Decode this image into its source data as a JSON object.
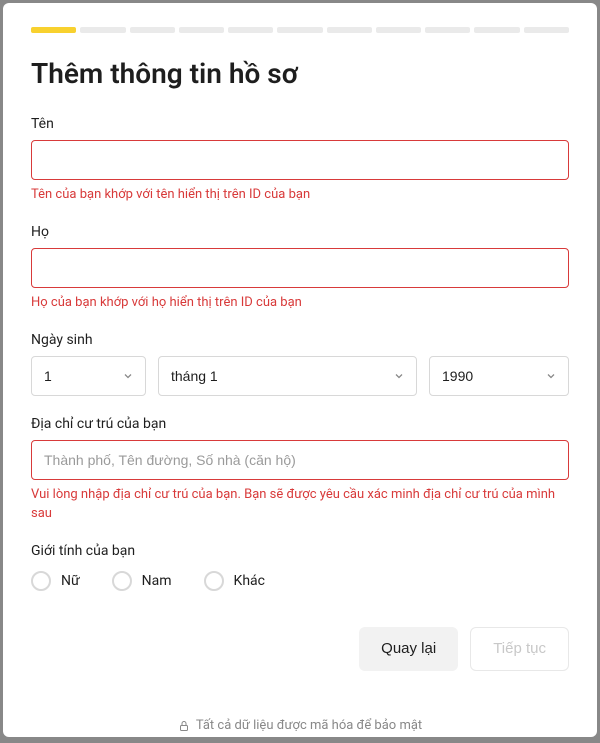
{
  "progress": {
    "total_segments": 11,
    "active_segment": 0
  },
  "title": "Thêm thông tin hồ sơ",
  "fields": {
    "first_name": {
      "label": "Tên",
      "value": "",
      "error": "Tên của bạn khớp với tên hiển thị trên ID của bạn"
    },
    "last_name": {
      "label": "Họ",
      "value": "",
      "error": "Họ của bạn khớp với họ hiển thị trên ID của bạn"
    },
    "dob": {
      "label": "Ngày sinh",
      "day": "1",
      "month": "tháng 1",
      "year": "1990"
    },
    "address": {
      "label": "Địa chỉ cư trú của bạn",
      "placeholder": "Thành phố, Tên đường, Số nhà (căn hộ)",
      "value": "",
      "error": "Vui lòng nhập địa chỉ cư trú của bạn. Bạn sẽ được yêu cầu xác minh địa chỉ cư trú của mình sau"
    },
    "gender": {
      "label": "Giới tính của bạn",
      "options": [
        {
          "label": "Nữ"
        },
        {
          "label": "Nam"
        },
        {
          "label": "Khác"
        }
      ]
    }
  },
  "buttons": {
    "back": "Quay lại",
    "continue": "Tiếp tục"
  },
  "footer": "Tất cả dữ liệu được mã hóa để bảo mật"
}
